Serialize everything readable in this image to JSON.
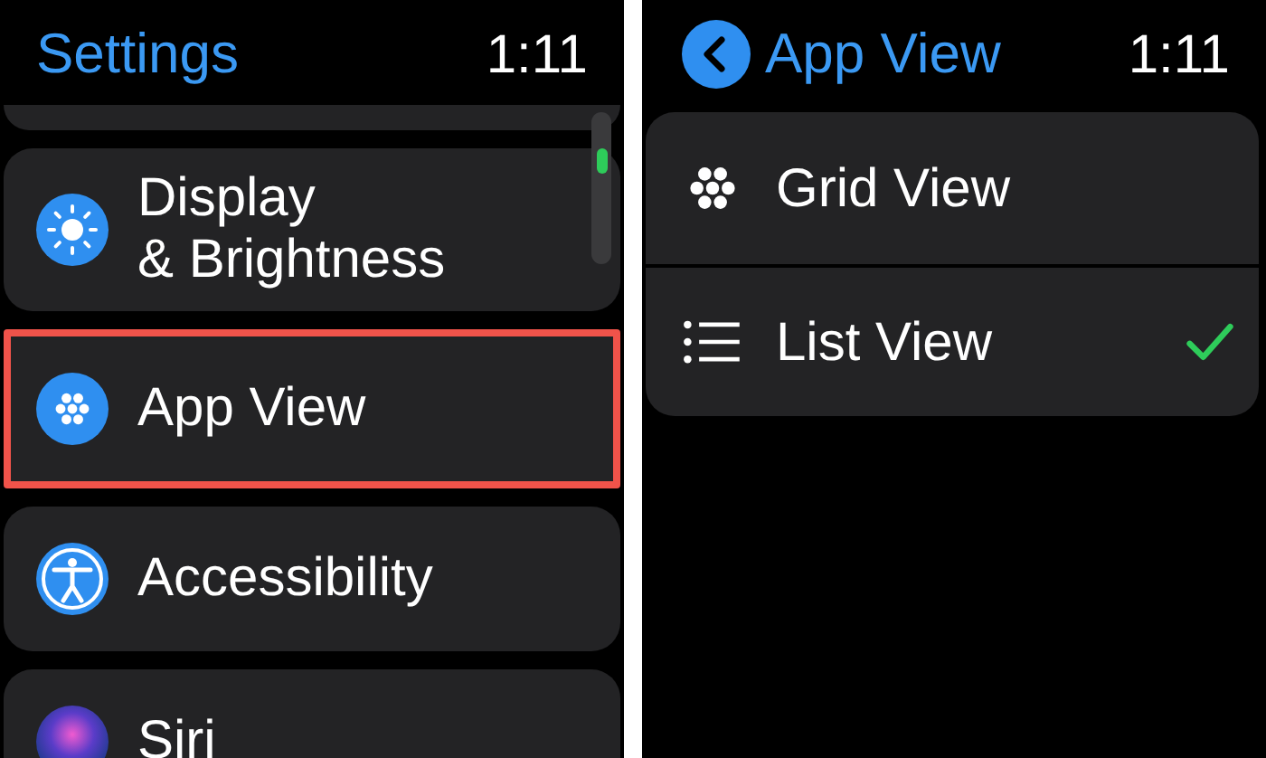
{
  "settings_screen": {
    "title": "Settings",
    "time": "1:11",
    "items": [
      {
        "kind": "partial"
      },
      {
        "kind": "brightness",
        "label": "Display\n& Brightness",
        "highlighted": false
      },
      {
        "kind": "app-view",
        "label": "App View",
        "highlighted": true
      },
      {
        "kind": "accessibility",
        "label": "Accessibility",
        "highlighted": false
      },
      {
        "kind": "siri",
        "label": "Siri",
        "highlighted": false
      }
    ]
  },
  "app_view_screen": {
    "title": "App View",
    "time": "1:11",
    "options": [
      {
        "kind": "grid",
        "label": "Grid View",
        "selected": false
      },
      {
        "kind": "list",
        "label": "List View",
        "selected": true
      }
    ]
  }
}
